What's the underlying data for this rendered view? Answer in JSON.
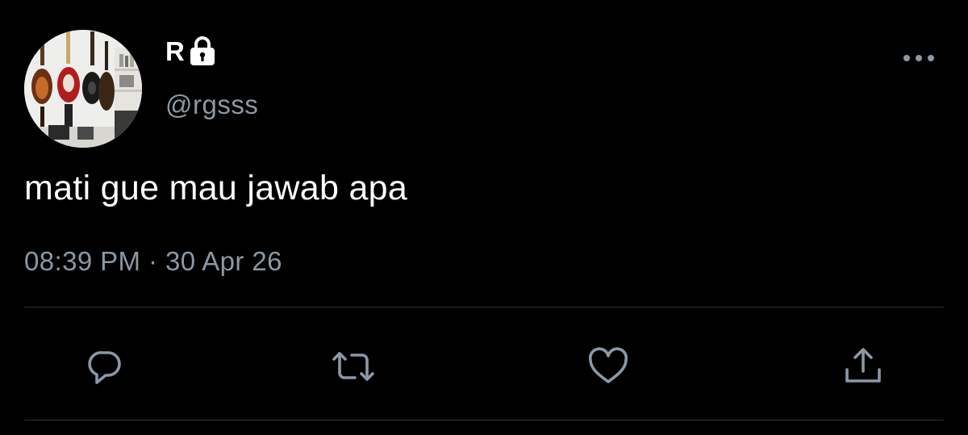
{
  "tweet": {
    "display_name": "R",
    "handle": "@rgsss",
    "text": "mati gue mau jawab apa",
    "time": "08:39 PM",
    "separator": "·",
    "date": "30 Apr 26"
  },
  "icons": {
    "lock": "lock-icon",
    "more": "more-icon",
    "reply": "reply-icon",
    "retweet": "retweet-icon",
    "like": "like-icon",
    "share": "share-icon"
  },
  "colors": {
    "background": "#000000",
    "primary_text": "#ffffff",
    "secondary_text": "#8b98a5",
    "divider": "#2f3336"
  }
}
